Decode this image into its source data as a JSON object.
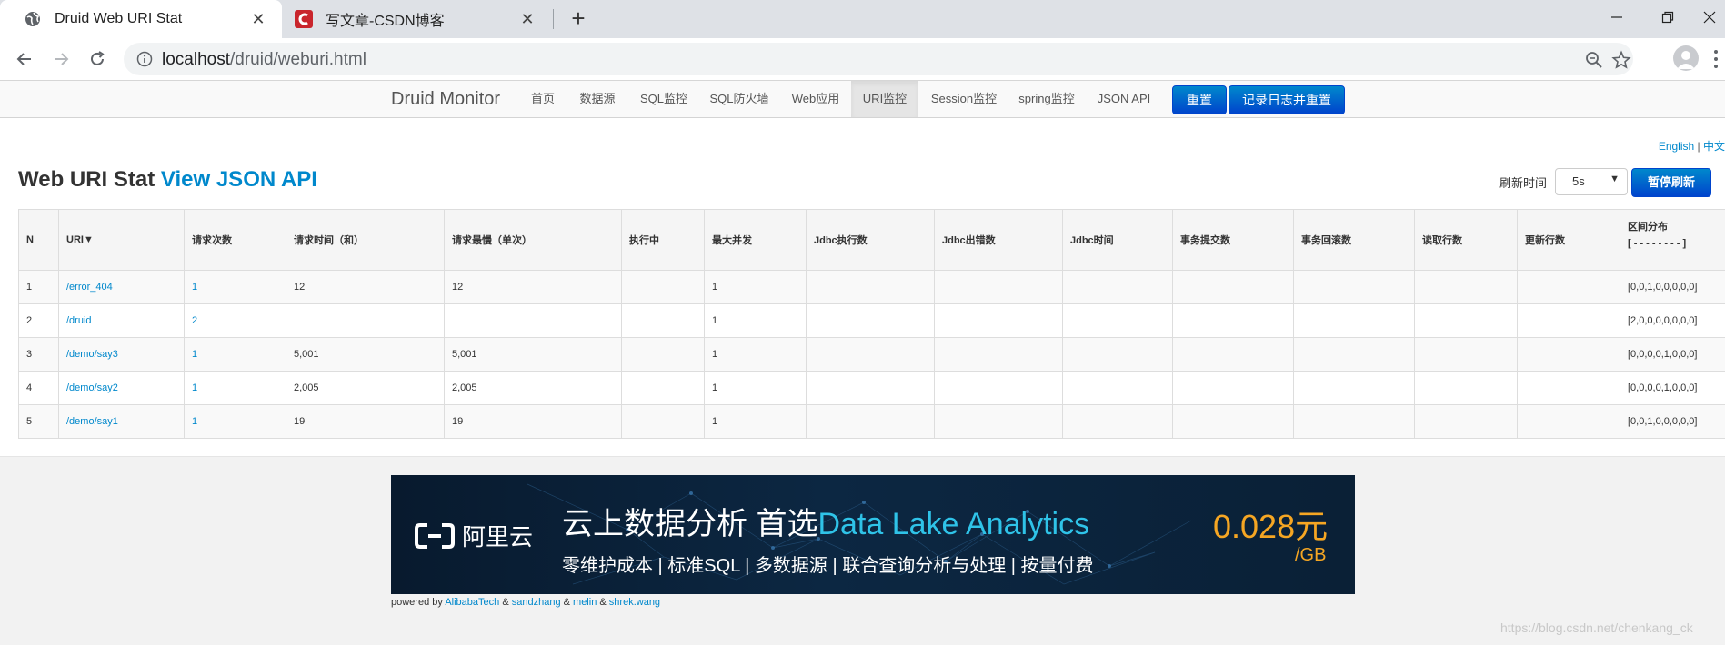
{
  "browser": {
    "tabs": [
      {
        "title": "Druid Web URI Stat",
        "active": true,
        "icon": "globe-icon"
      },
      {
        "title": "写文章-CSDN博客",
        "active": false,
        "icon": "csdn-logo-icon"
      }
    ],
    "new_tab": "+",
    "url_host": "localhost",
    "url_path": "/druid/weburi.html"
  },
  "nav": {
    "brand": "Druid Monitor",
    "items": [
      "首页",
      "数据源",
      "SQL监控",
      "SQL防火墙",
      "Web应用",
      "URI监控",
      "Session监控",
      "spring监控",
      "JSON API"
    ],
    "active_item": "URI监控",
    "reset_button": "重置",
    "log_reset_button": "记录日志并重置"
  },
  "lang": {
    "english": "English",
    "separator": "|",
    "chinese": "中文"
  },
  "page": {
    "title": "Web URI Stat",
    "json_api_link": "View JSON API",
    "refresh_label": "刷新时间",
    "refresh_value": "5s",
    "pause_button": "暂停刷新"
  },
  "table": {
    "columns": [
      "N",
      "URI▼",
      "请求次数",
      "请求时间（和）",
      "请求最慢（单次）",
      "执行中",
      "最大并发",
      "Jdbc执行数",
      "Jdbc出错数",
      "Jdbc时间",
      "事务提交数",
      "事务回滚数",
      "读取行数",
      "更新行数",
      "区间分布"
    ],
    "histogram_legend": "[ - - - - - - - - ]",
    "rows": [
      {
        "n": "1",
        "uri": "/error_404",
        "requests": "1",
        "time_sum": "12",
        "slowest": "12",
        "running": "",
        "max_concurrent": "1",
        "jdbc_exec": "",
        "jdbc_err": "",
        "jdbc_time": "",
        "tx_commit": "",
        "tx_rollback": "",
        "rows_read": "",
        "rows_updated": "",
        "histogram": "[0,0,1,0,0,0,0,0]"
      },
      {
        "n": "2",
        "uri": "/druid",
        "requests": "2",
        "time_sum": "",
        "slowest": "",
        "running": "",
        "max_concurrent": "1",
        "jdbc_exec": "",
        "jdbc_err": "",
        "jdbc_time": "",
        "tx_commit": "",
        "tx_rollback": "",
        "rows_read": "",
        "rows_updated": "",
        "histogram": "[2,0,0,0,0,0,0,0]"
      },
      {
        "n": "3",
        "uri": "/demo/say3",
        "requests": "1",
        "time_sum": "5,001",
        "slowest": "5,001",
        "running": "",
        "max_concurrent": "1",
        "jdbc_exec": "",
        "jdbc_err": "",
        "jdbc_time": "",
        "tx_commit": "",
        "tx_rollback": "",
        "rows_read": "",
        "rows_updated": "",
        "histogram": "[0,0,0,0,1,0,0,0]"
      },
      {
        "n": "4",
        "uri": "/demo/say2",
        "requests": "1",
        "time_sum": "2,005",
        "slowest": "2,005",
        "running": "",
        "max_concurrent": "1",
        "jdbc_exec": "",
        "jdbc_err": "",
        "jdbc_time": "",
        "tx_commit": "",
        "tx_rollback": "",
        "rows_read": "",
        "rows_updated": "",
        "histogram": "[0,0,0,0,1,0,0,0]"
      },
      {
        "n": "5",
        "uri": "/demo/say1",
        "requests": "1",
        "time_sum": "19",
        "slowest": "19",
        "running": "",
        "max_concurrent": "1",
        "jdbc_exec": "",
        "jdbc_err": "",
        "jdbc_time": "",
        "tx_commit": "",
        "tx_rollback": "",
        "rows_read": "",
        "rows_updated": "",
        "histogram": "[0,0,1,0,0,0,0,0]"
      }
    ]
  },
  "banner": {
    "logo_text": "阿里云",
    "headline_prefix": "云上数据分析 首选",
    "headline_product": "Data Lake Analytics",
    "subline": "零维护成本 | 标准SQL | 多数据源 | 联合查询分析与处理 | 按量付费",
    "price": "0.028元",
    "unit": "/GB",
    "colors": {
      "highlight": "#2fc3e8",
      "price": "#f5a623"
    }
  },
  "footer": {
    "powered_by": "powered by",
    "amp": "&",
    "credits": [
      "AlibabaTech",
      "sandzhang",
      "melin",
      "shrek.wang"
    ],
    "watermark": "https://blog.csdn.net/chenkang_ck"
  },
  "colors": {
    "link": "#0088cc",
    "button": "#0055cc",
    "tabstrip": "#dee1e6"
  }
}
